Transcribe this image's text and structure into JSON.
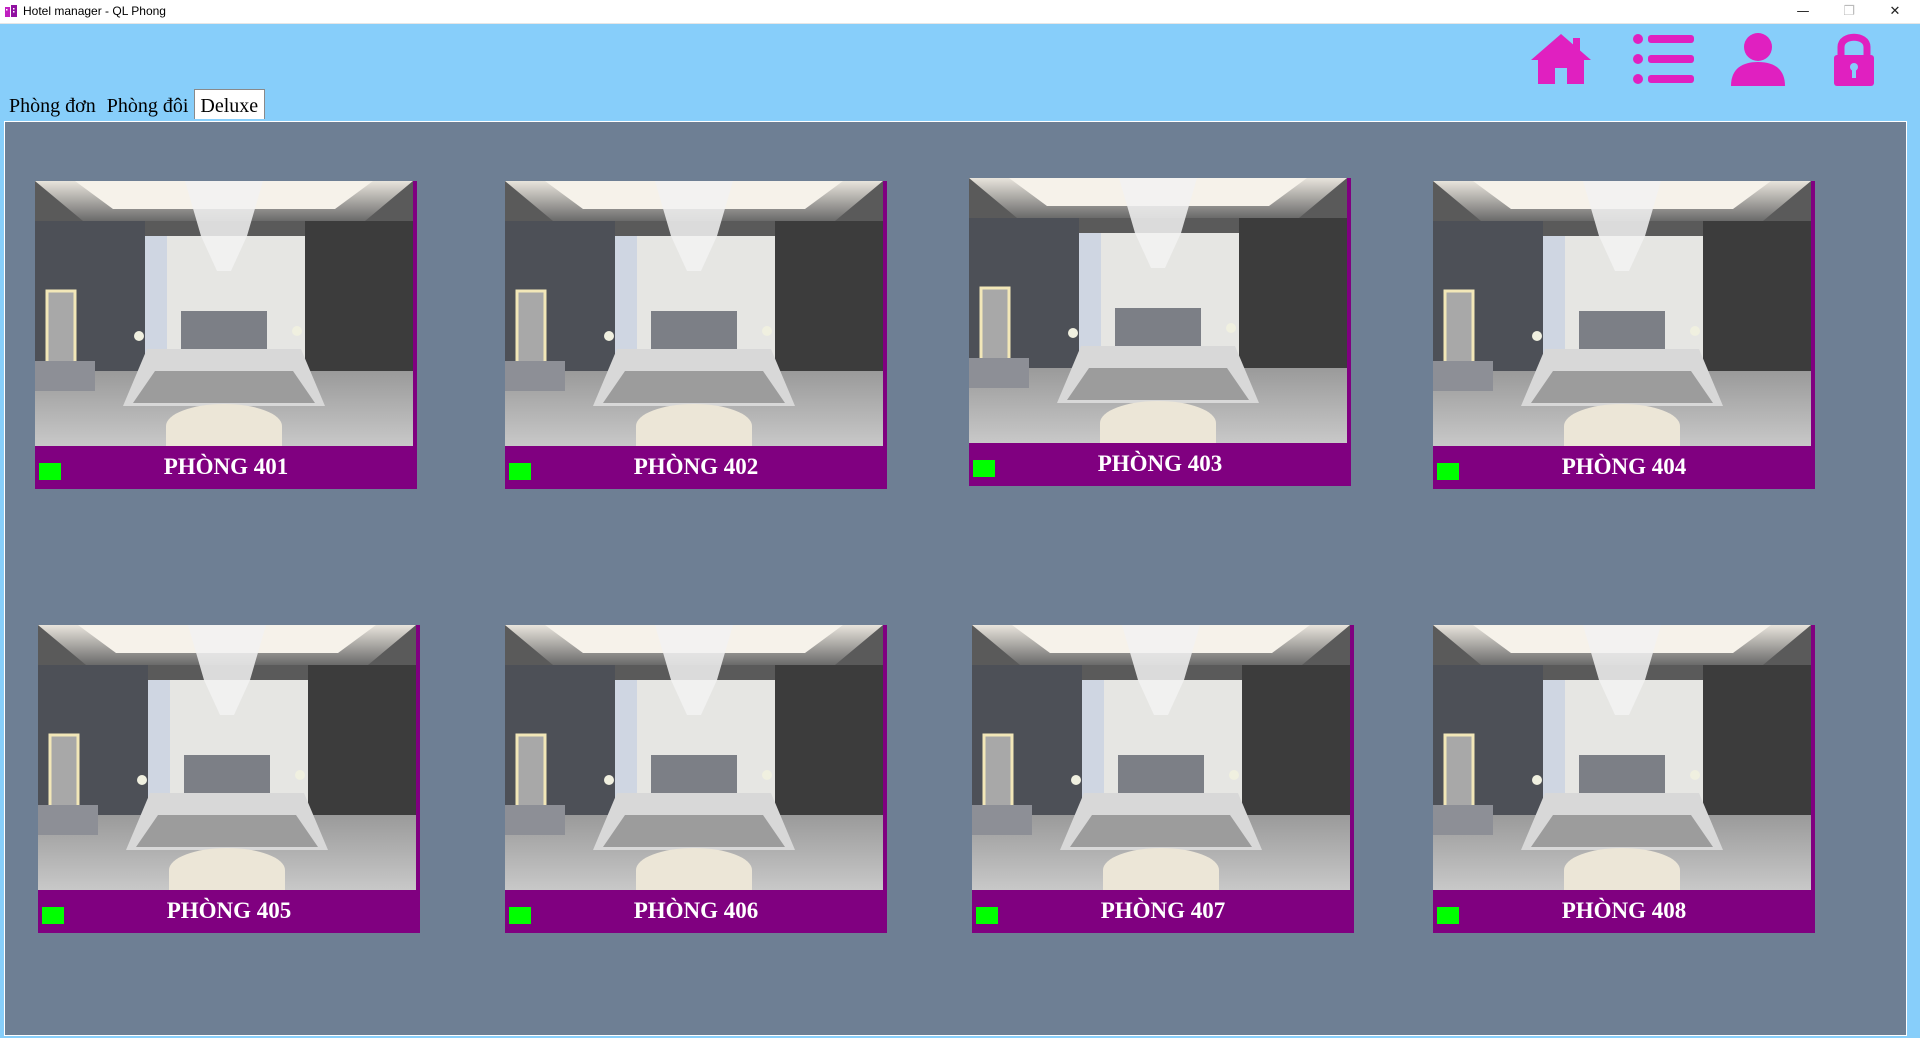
{
  "window": {
    "title": "Hotel manager - QL Phong",
    "minimize_glyph": "—",
    "maximize_glyph": "❐",
    "close_glyph": "✕"
  },
  "toolbar": {
    "accent_color": "#e020c0",
    "icons": [
      "home-icon",
      "list-icon",
      "user-icon",
      "lock-icon"
    ]
  },
  "tabs": [
    {
      "label": "Phòng đơn",
      "active": false
    },
    {
      "label": "Phòng đôi",
      "active": false
    },
    {
      "label": "Deluxe",
      "active": true
    }
  ],
  "panel": {
    "background": "#6e7f94"
  },
  "rooms": [
    {
      "label": "PHÒNG 401",
      "status": "available",
      "status_color": "#00ff00"
    },
    {
      "label": "PHÒNG 402",
      "status": "available",
      "status_color": "#00ff00"
    },
    {
      "label": "PHÒNG 403",
      "status": "available",
      "status_color": "#00ff00"
    },
    {
      "label": "PHÒNG 404",
      "status": "available",
      "status_color": "#00ff00"
    },
    {
      "label": "PHÒNG 405",
      "status": "available",
      "status_color": "#00ff00"
    },
    {
      "label": "PHÒNG 406",
      "status": "available",
      "status_color": "#00ff00"
    },
    {
      "label": "PHÒNG 407",
      "status": "available",
      "status_color": "#00ff00"
    },
    {
      "label": "PHÒNG 408",
      "status": "available",
      "status_color": "#00ff00"
    }
  ]
}
